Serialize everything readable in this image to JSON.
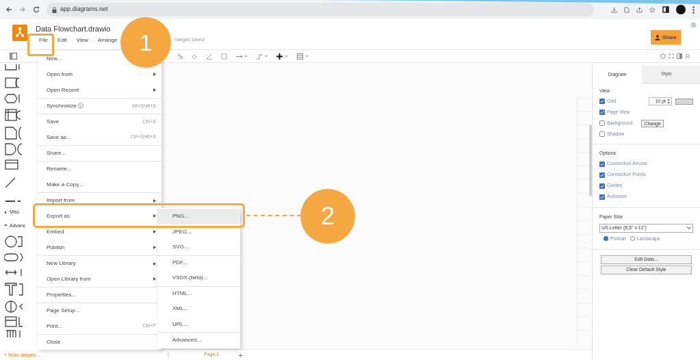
{
  "browser": {
    "url": "app.diagrams.net"
  },
  "app": {
    "title": "Data Flowchart.drawio",
    "menus": [
      "File",
      "Edit",
      "View",
      "Arrange"
    ],
    "save_status": "hanges saved",
    "share_label": "Share"
  },
  "sidebar": {
    "sections": [
      {
        "label": "Misc",
        "expanded": false
      },
      {
        "label": "Advanc",
        "expanded": true
      }
    ],
    "more_shapes": "+ More shapes..."
  },
  "file_menu": {
    "items": [
      {
        "label": "New...",
        "has_submenu": false,
        "divider": false
      },
      {
        "label": "Open from",
        "has_submenu": true,
        "divider": false
      },
      {
        "label": "Open Recent",
        "has_submenu": true,
        "divider": false
      },
      {
        "label": "Synchronize ⓘ",
        "shortcut": "Alt+Shift+S",
        "has_submenu": false,
        "divider": true
      },
      {
        "label": "Save",
        "shortcut": "Ctrl+S",
        "has_submenu": false,
        "divider": true
      },
      {
        "label": "Save as...",
        "shortcut": "Ctrl+Shift+S",
        "has_submenu": false,
        "divider": false
      },
      {
        "label": "Share...",
        "has_submenu": false,
        "divider": true
      },
      {
        "label": "Rename...",
        "has_submenu": false,
        "divider": true
      },
      {
        "label": "Make a Copy...",
        "has_submenu": false,
        "divider": false
      },
      {
        "label": "Import from",
        "has_submenu": true,
        "divider": true
      },
      {
        "label": "Export as",
        "has_submenu": true,
        "divider": false
      },
      {
        "label": "Embed",
        "has_submenu": true,
        "divider": false
      },
      {
        "label": "Publish",
        "has_submenu": true,
        "divider": false
      },
      {
        "label": "New Library",
        "has_submenu": true,
        "divider": true
      },
      {
        "label": "Open Library from",
        "has_submenu": true,
        "divider": false
      },
      {
        "label": "Properties...",
        "has_submenu": false,
        "divider": true
      },
      {
        "label": "Page Setup...",
        "has_submenu": false,
        "divider": true
      },
      {
        "label": "Print...",
        "shortcut": "Ctrl+P",
        "has_submenu": false,
        "divider": false
      },
      {
        "label": "Close",
        "has_submenu": false,
        "divider": true
      }
    ]
  },
  "export_menu": {
    "items": [
      {
        "label": "PNG...",
        "selected": true,
        "divider": false
      },
      {
        "label": "JPEG...",
        "selected": false,
        "divider": false
      },
      {
        "label": "SVG...",
        "selected": false,
        "divider": false
      },
      {
        "label": "PDF...",
        "selected": false,
        "divider": true
      },
      {
        "label": "VSDX (beta)...",
        "selected": false,
        "divider": false
      },
      {
        "label": "HTML...",
        "selected": false,
        "divider": true
      },
      {
        "label": "XML...",
        "selected": false,
        "divider": false
      },
      {
        "label": "URL...",
        "selected": false,
        "divider": false
      },
      {
        "label": "Advanced...",
        "selected": false,
        "divider": true
      }
    ]
  },
  "callouts": [
    {
      "number": "1"
    },
    {
      "number": "2"
    }
  ],
  "page_bar": {
    "menu_icon": "⋮",
    "tabs": [
      {
        "label": "Page-1",
        "selected": true
      }
    ],
    "add_page": "+"
  },
  "format_panel": {
    "tabs": [
      {
        "label": "Diagram",
        "selected": true
      },
      {
        "label": "Style",
        "selected": false
      }
    ],
    "view_heading": "View",
    "view_options": [
      {
        "label": "Grid",
        "checked": true,
        "field_value": "10 pt"
      },
      {
        "label": "Page View",
        "checked": true
      },
      {
        "label": "Background",
        "checked": false,
        "button": "Change"
      },
      {
        "label": "Shadow",
        "checked": false
      }
    ],
    "options_heading": "Options",
    "options": [
      {
        "label": "Connection Arrows",
        "checked": true
      },
      {
        "label": "Connection Points",
        "checked": true
      },
      {
        "label": "Guides",
        "checked": true
      },
      {
        "label": "Autosave",
        "checked": true
      }
    ],
    "paper_heading": "Paper Size",
    "paper_size": "US-Letter (8,5\" x 11\")",
    "orientation": [
      {
        "label": "Portrait",
        "selected": true
      },
      {
        "label": "Landscape",
        "selected": false
      }
    ],
    "buttons": [
      "Edit Data...",
      "Clear Default Style"
    ]
  }
}
